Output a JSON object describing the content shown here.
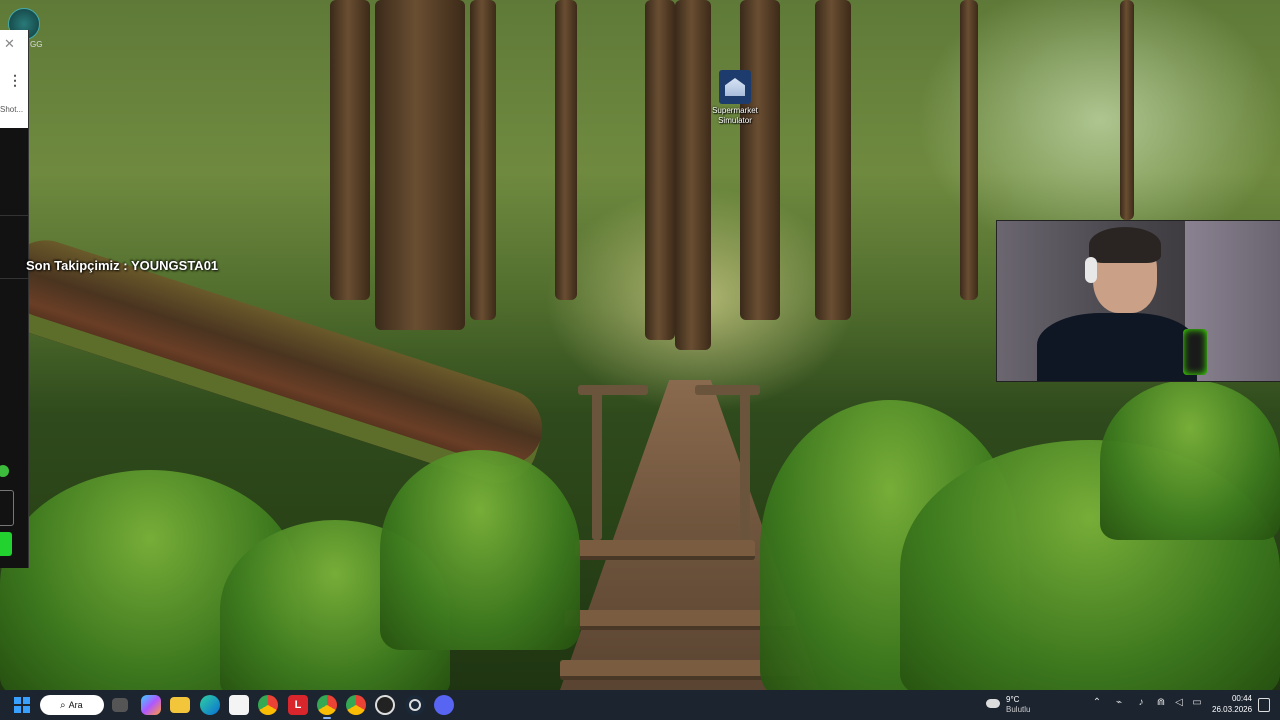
{
  "overlay": {
    "follower_text": "Son Takipçimiz : YOUNGSTA01"
  },
  "top_left_app": {
    "label": "GG",
    "shot_label": "Shot..."
  },
  "desktop": {
    "icons": [
      {
        "name": "supermarket-simulator",
        "label": "Supermarket Simulator"
      }
    ]
  },
  "taskbar": {
    "search_label": "Ara",
    "pinned": [
      "file-explorer-icon",
      "copilot-icon",
      "folder-icon",
      "edge-icon",
      "store-icon",
      "chrome-icon",
      "l-app-icon",
      "chrome-active-icon",
      "chrome-icon-2",
      "obs-icon",
      "steam-icon",
      "discord-icon"
    ],
    "l_app_letter": "L"
  },
  "tray": {
    "weather_temp": "9°C",
    "weather_condition": "Bulutlu",
    "time": "00:44",
    "date": "26.03.2026"
  },
  "colors": {
    "taskbar_bg": "#1c2430",
    "accent": "#3aa0ff",
    "green_button": "#22d22e"
  }
}
